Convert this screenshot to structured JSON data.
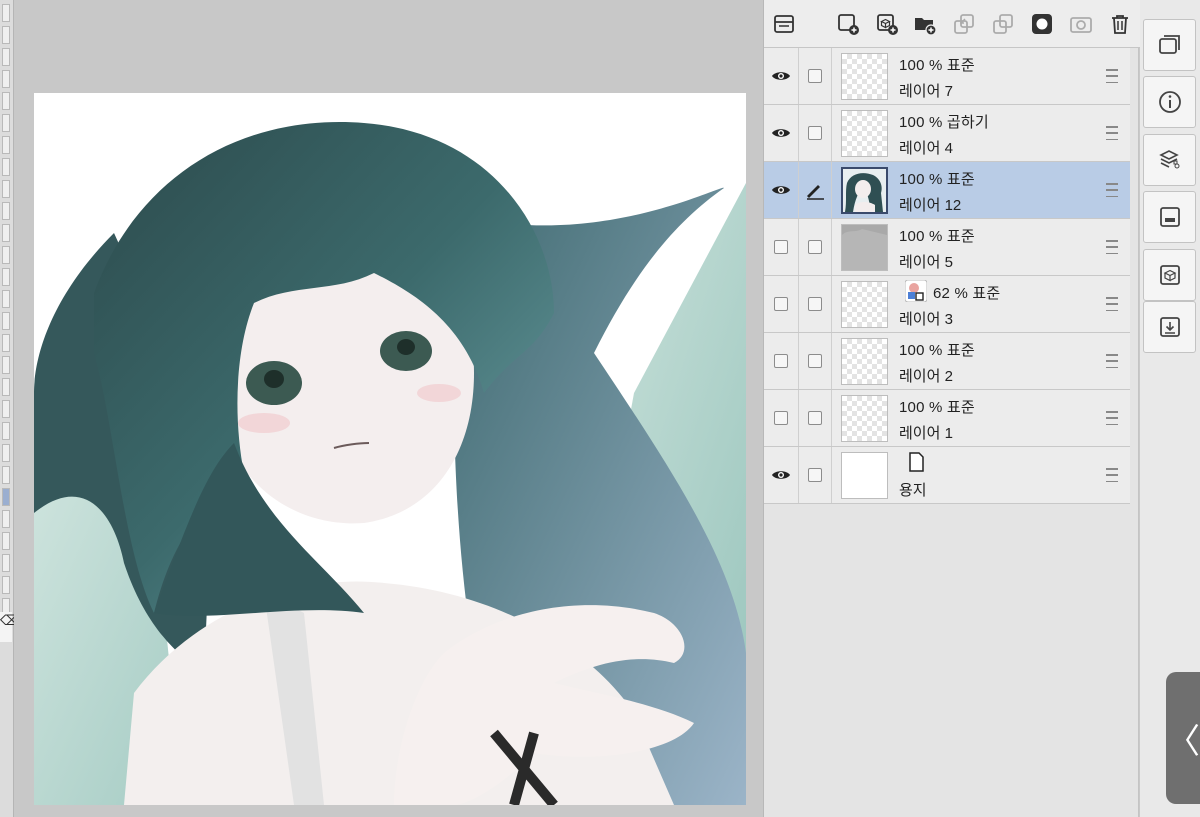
{
  "toolbar": {
    "buttons": [
      {
        "name": "layer-property-icon"
      },
      {
        "name": "new-raster-layer-icon"
      },
      {
        "name": "new-vector-layer-icon"
      },
      {
        "name": "new-folder-icon"
      },
      {
        "name": "merge-down-icon"
      },
      {
        "name": "merge-visible-icon"
      },
      {
        "name": "layer-mask-icon"
      },
      {
        "name": "layer-camera-icon"
      },
      {
        "name": "delete-layer-icon"
      }
    ]
  },
  "layers": [
    {
      "mode": "100 % 표준",
      "name": "레이어 7",
      "visible": true,
      "thumb": "checker",
      "selected": false
    },
    {
      "mode": "100 % 곱하기",
      "name": "레이어 4",
      "visible": true,
      "thumb": "checker",
      "selected": false
    },
    {
      "mode": "100 % 표준",
      "name": "레이어 12",
      "visible": true,
      "thumb": "art",
      "selected": true,
      "editing": true
    },
    {
      "mode": "100 % 표준",
      "name": "레이어 5",
      "visible": false,
      "thumb": "gray",
      "selected": false
    },
    {
      "mode": "62 % 표준",
      "name": "레이어 3",
      "visible": false,
      "thumb": "checker",
      "selected": false,
      "has_mode_icon": true
    },
    {
      "mode": "100 % 표준",
      "name": "레이어 2",
      "visible": false,
      "thumb": "checker",
      "selected": false
    },
    {
      "mode": "100 % 표준",
      "name": "레이어 1",
      "visible": false,
      "thumb": "checker",
      "selected": false
    },
    {
      "mode": "",
      "name": "용지",
      "visible": true,
      "thumb": "white",
      "selected": false,
      "paper": true
    }
  ],
  "sidebar": {
    "buttons": [
      "layers-panel-icon",
      "info-icon",
      "material-icon",
      "navigator-icon",
      "3d-icon",
      "import-icon"
    ]
  },
  "collapse_glyph": "〈"
}
